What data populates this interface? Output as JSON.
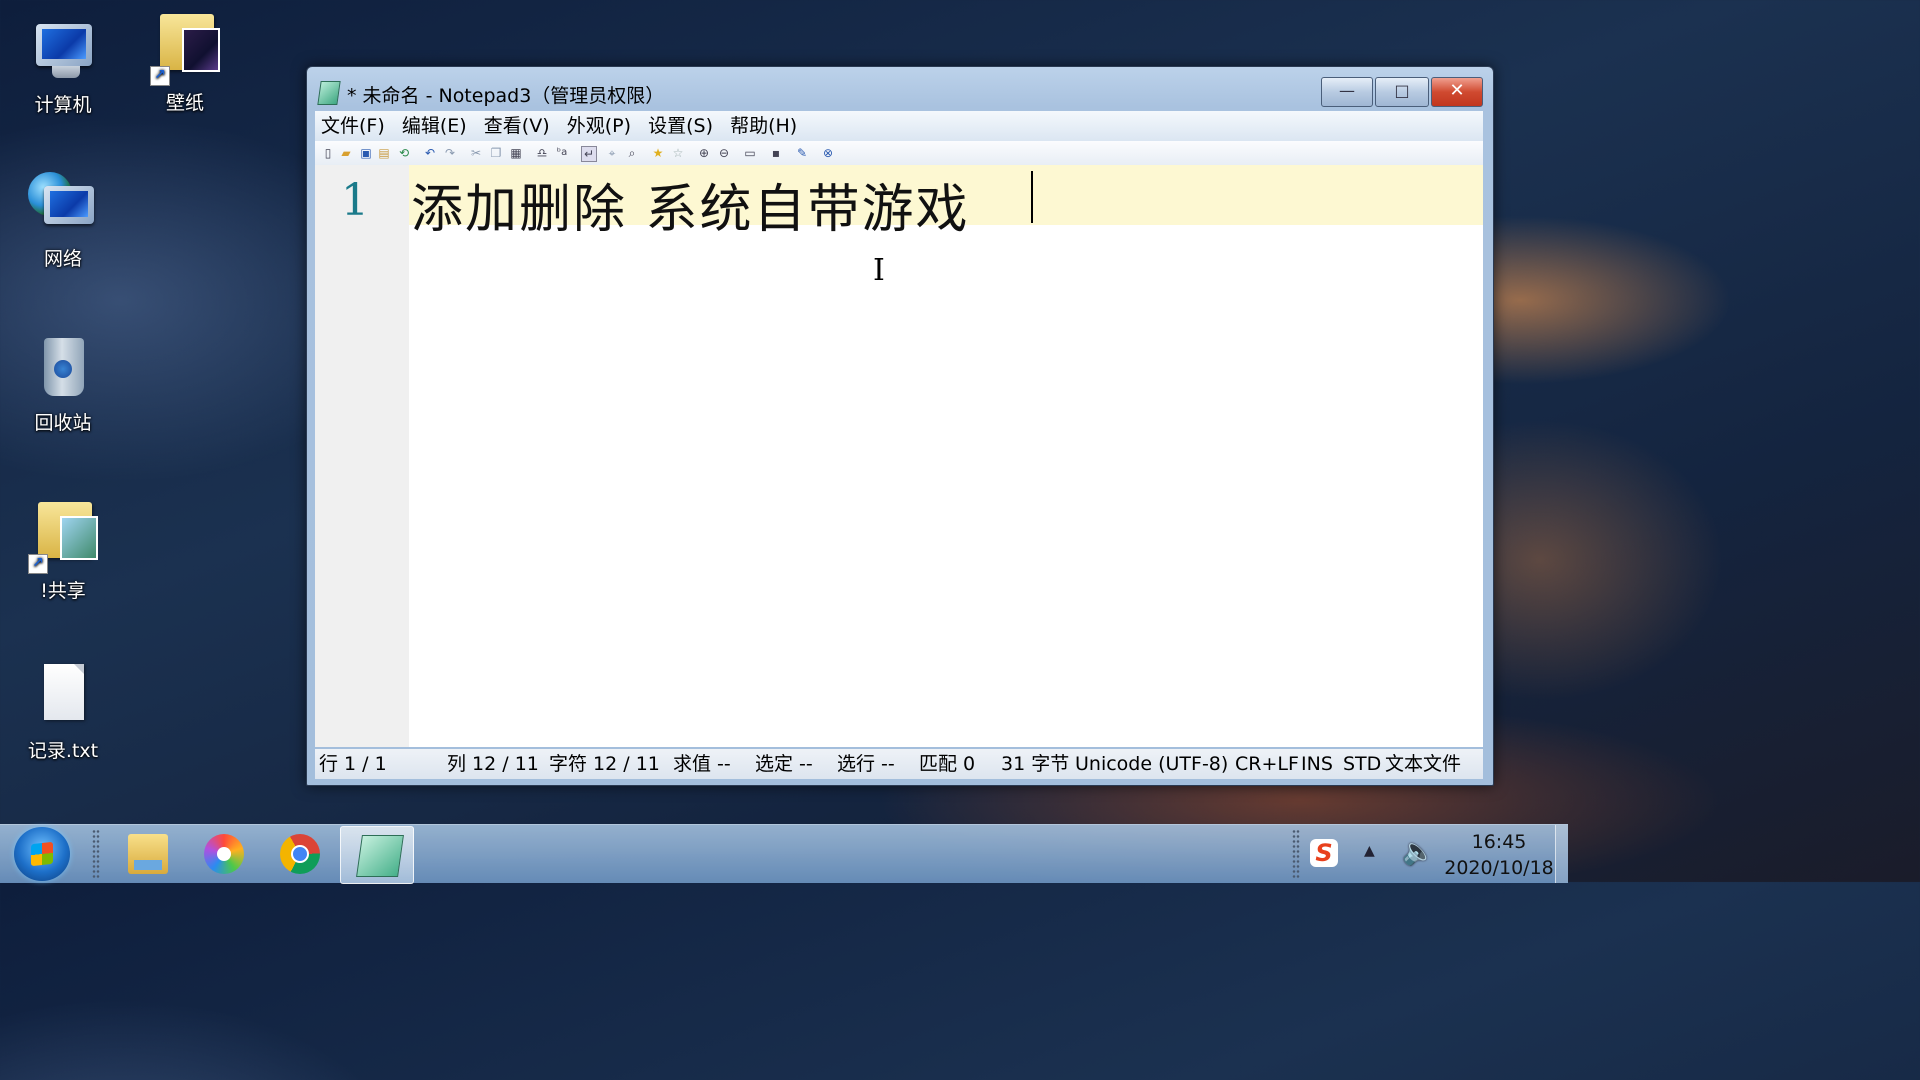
{
  "desktop": {
    "icons": [
      {
        "label": "计算机"
      },
      {
        "label": "壁纸"
      },
      {
        "label": "网络"
      },
      {
        "label": "回收站"
      },
      {
        "label": "!共享"
      },
      {
        "label": "记录.txt"
      }
    ]
  },
  "window": {
    "title": "* 未命名 - Notepad3（管理员权限）",
    "controls": {
      "minimize": "—",
      "maximize": "□",
      "close": "✕"
    },
    "menu": [
      "文件(F)",
      "编辑(E)",
      "查看(V)",
      "外观(P)",
      "设置(S)",
      "帮助(H)"
    ],
    "toolbar_icons": [
      "new-icon",
      "open-icon",
      "save-icon",
      "save-as-icon",
      "revert-icon",
      "undo-icon",
      "redo-icon",
      "cut-icon",
      "copy-icon",
      "paste-icon",
      "find-icon",
      "replace-icon",
      "word-wrap-icon",
      "find-next-icon",
      "goto-icon",
      "favorites-icon",
      "add-favorite-icon",
      "zoom-in-icon",
      "zoom-out-icon",
      "view-icon",
      "fullscreen-icon",
      "pin-icon",
      "exit-icon"
    ],
    "editor": {
      "line_number": "1",
      "line_text": "添加删除  系统自带游戏"
    },
    "status": {
      "line": "行  1 / 1",
      "col": "列  12 / 11",
      "chars": "字符  12 / 11",
      "eval": "求值  --",
      "sel": "选定  --",
      "sel_lines": "选行  --",
      "match": "匹配  0",
      "bytes": "31 字节",
      "encoding": "Unicode (UTF-8)",
      "eol": "CR+LF",
      "ins": "INS",
      "std": "STD",
      "filetype": "文本文件"
    }
  },
  "taskbar": {
    "clock_time": "16:45",
    "clock_date": "2020/10/18",
    "tray_ime": "S"
  }
}
